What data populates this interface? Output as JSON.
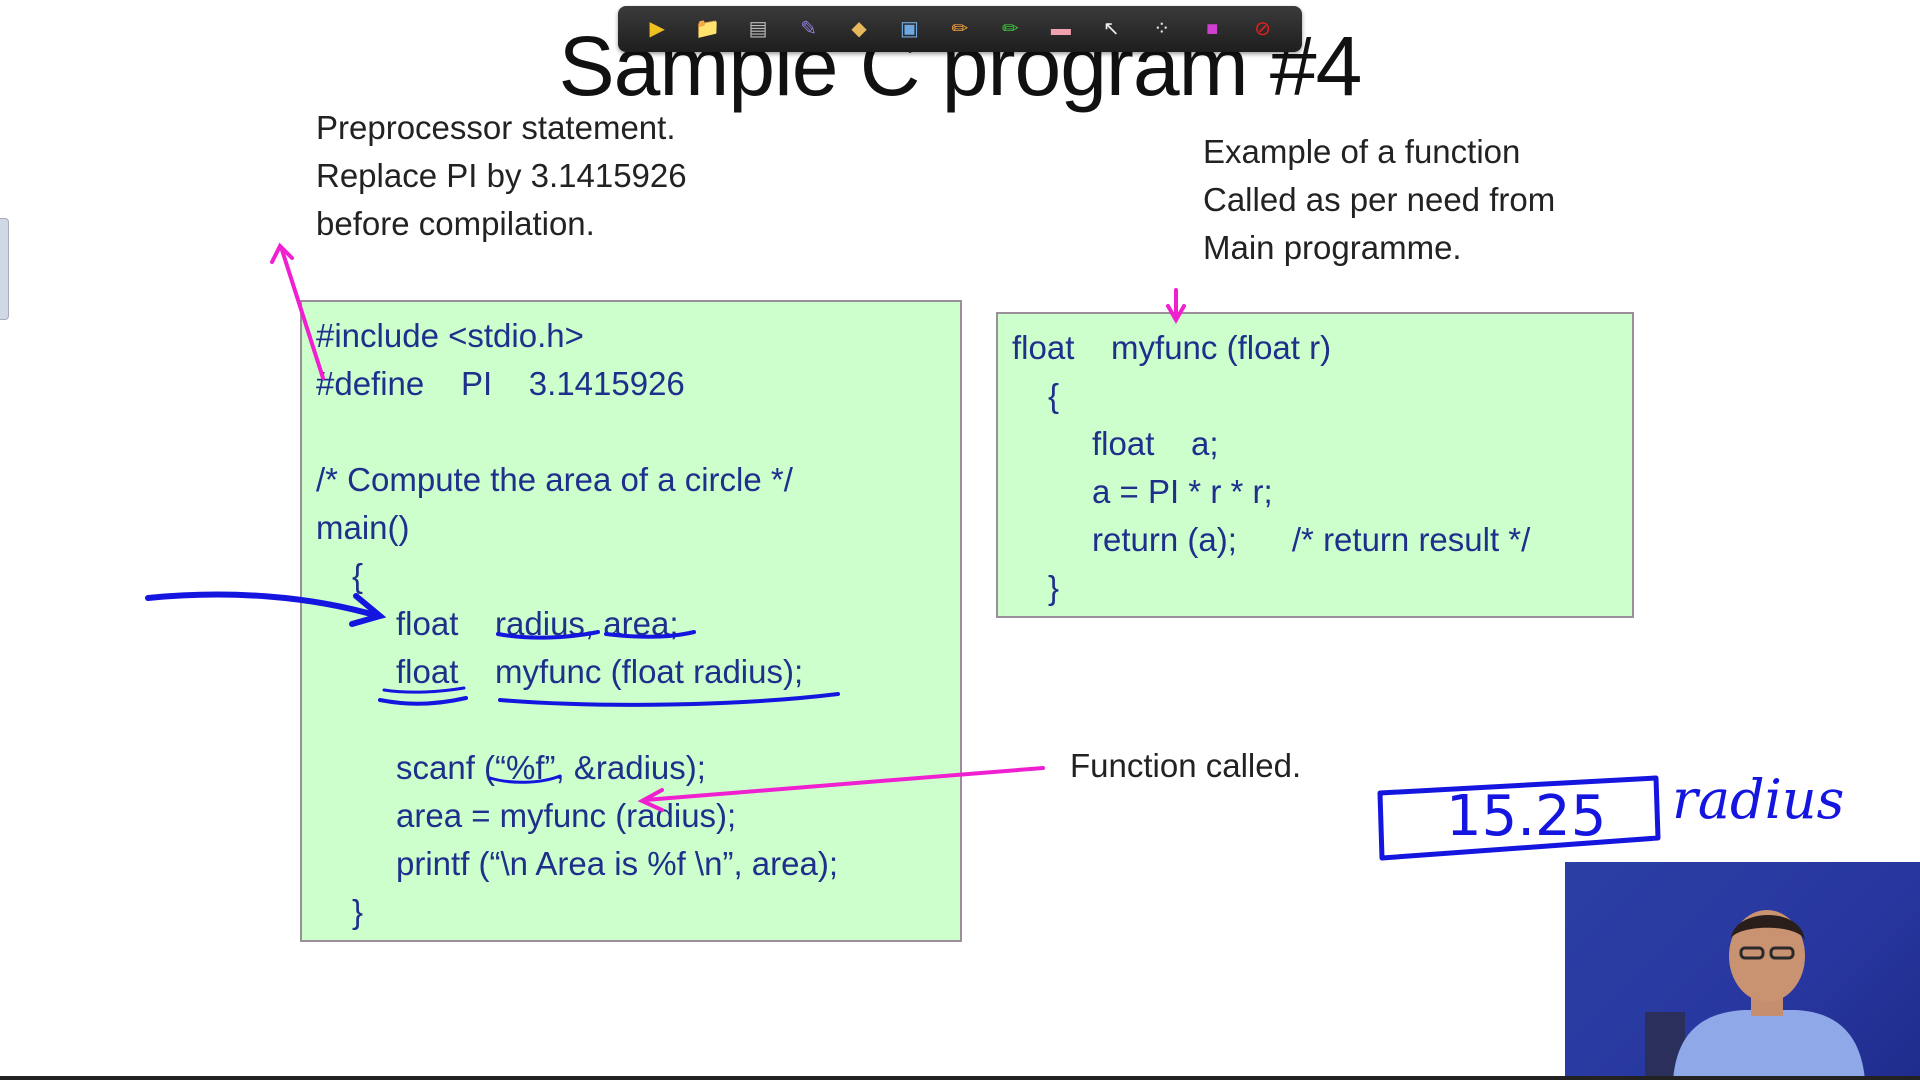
{
  "slide": {
    "title": "Sample C program #4"
  },
  "toolbar": {
    "tools": [
      {
        "icon": "next-arrow-icon",
        "glyph": "▶",
        "color": "#f0c020"
      },
      {
        "icon": "folder-icon",
        "glyph": "📁",
        "color": "#f0c020"
      },
      {
        "icon": "save-icon",
        "glyph": "▤",
        "color": "#bbbbbb"
      },
      {
        "icon": "pen-icon",
        "glyph": "✎",
        "color": "#8f7bd8"
      },
      {
        "icon": "highlighter-icon",
        "glyph": "◆",
        "color": "#e6b85c"
      },
      {
        "icon": "screen-icon",
        "glyph": "▣",
        "color": "#6fa8e0"
      },
      {
        "icon": "pencil-icon",
        "glyph": "✏",
        "color": "#f0a040"
      },
      {
        "icon": "marker-icon",
        "glyph": "✏",
        "color": "#3cc43c"
      },
      {
        "icon": "eraser-icon",
        "glyph": "▬",
        "color": "#f0a0b0"
      },
      {
        "icon": "pointer-icon",
        "glyph": "↖",
        "color": "#eeeeee"
      },
      {
        "icon": "laser-icon",
        "glyph": "⁘",
        "color": "#eeeeee"
      },
      {
        "icon": "color-palette-icon",
        "glyph": "■",
        "color": "#d040d0"
      },
      {
        "icon": "stop-icon",
        "glyph": "⊘",
        "color": "#e02020"
      }
    ]
  },
  "notes": {
    "preprocessor": [
      "Preprocessor statement.",
      "Replace PI by 3.1415926",
      "before compilation."
    ],
    "function_example": [
      "Example of a function",
      "Called as per need from",
      "Main programme."
    ],
    "function_called": "Function called."
  },
  "main_code": [
    "#include <stdio.h>",
    "#define    PI    3.1415926",
    "",
    "/* Compute the area of a circle */",
    "main()",
    "{",
    "float    radius, area;",
    "float    myfunc (float radius);",
    "",
    "scanf (“%f”, &radius);",
    "area = myfunc (radius);",
    "printf (“\\n Area is %f \\n”, area);",
    "}"
  ],
  "func_code": [
    "float    myfunc (float r)",
    "{",
    "float    a;",
    "a = PI * r * r;",
    "return (a);      /* return result */",
    "}"
  ],
  "handwriting": {
    "value": "15.25",
    "label": "radius"
  },
  "ink_colors": {
    "magenta": "#f020d0",
    "blue": "#1515e0",
    "code_text": "#1f2f8c",
    "code_bg": "#ccffcc"
  }
}
